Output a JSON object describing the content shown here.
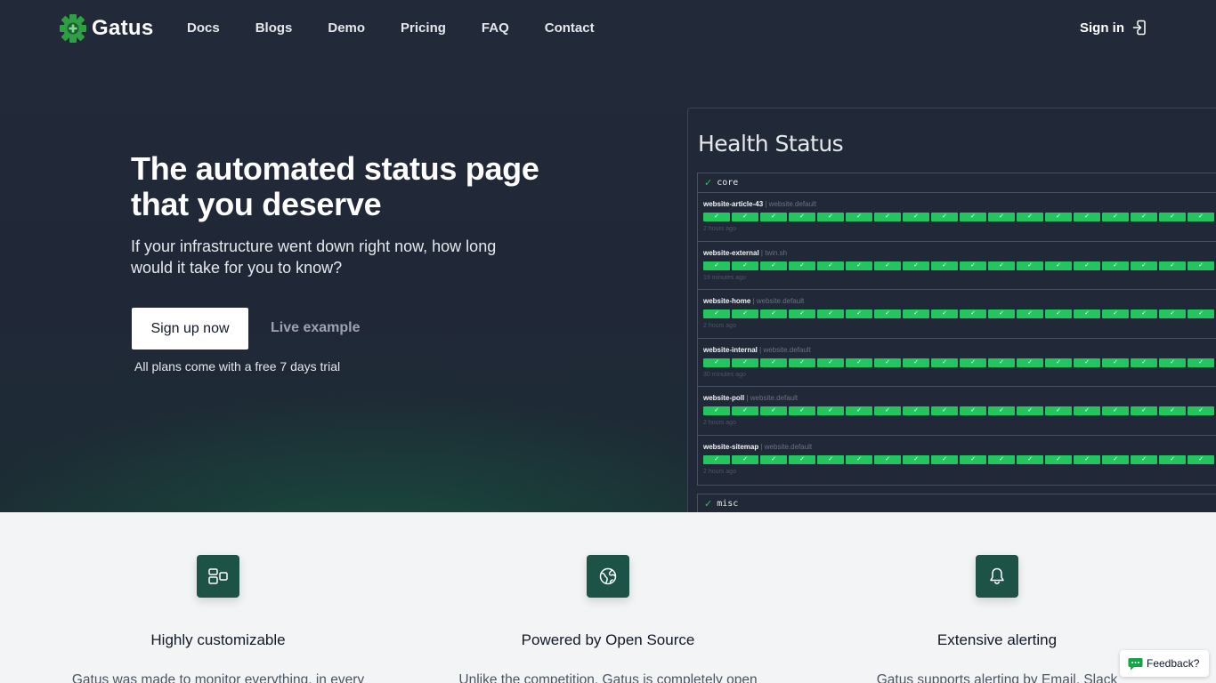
{
  "brand": {
    "name": "Gatus"
  },
  "nav": {
    "links": [
      "Docs",
      "Blogs",
      "Demo",
      "Pricing",
      "FAQ",
      "Contact"
    ],
    "signin_label": "Sign in"
  },
  "hero": {
    "headline": "The automated status page that you deserve",
    "subheadline": "If your infrastructure went down right now, how long would it take for you to know?",
    "signup_label": "Sign up now",
    "live_example_label": "Live example",
    "trial_note": "All plans come with a free 7 days trial"
  },
  "screenshot": {
    "title": "Health Status",
    "groups": [
      {
        "name": "core",
        "endpoints": [
          {
            "name": "website-article-43",
            "group": "website.default",
            "time": "2 hours ago"
          },
          {
            "name": "website-external",
            "group": "twin.sh",
            "time": "19 minutes ago"
          },
          {
            "name": "website-home",
            "group": "website.default",
            "time": "2 hours ago"
          },
          {
            "name": "website-internal",
            "group": "website.default",
            "time": "30 minutes ago"
          },
          {
            "name": "website-poll",
            "group": "website.default",
            "time": "2 hours ago"
          },
          {
            "name": "website-sitemap",
            "group": "website.default",
            "time": "2 hours ago"
          }
        ]
      },
      {
        "name": "misc",
        "endpoints": []
      }
    ],
    "bar_glyph": "✓",
    "check_glyph": "✓",
    "status_color": "#22c55e"
  },
  "features": [
    {
      "icon": "layout-icon",
      "title": "Highly customizable",
      "description": "Gatus was made to monitor everything, in every"
    },
    {
      "icon": "globe-icon",
      "title": "Powered by Open Source",
      "description": "Unlike the competition, Gatus is completely open"
    },
    {
      "icon": "bell-icon",
      "title": "Extensive alerting",
      "description": "Gatus supports alerting by Email, Slack"
    }
  ],
  "feedback": {
    "label": "Feedback?"
  },
  "colors": {
    "accent": "#1d5346",
    "hero_bg": "#222938",
    "status_green": "#22c55e"
  }
}
